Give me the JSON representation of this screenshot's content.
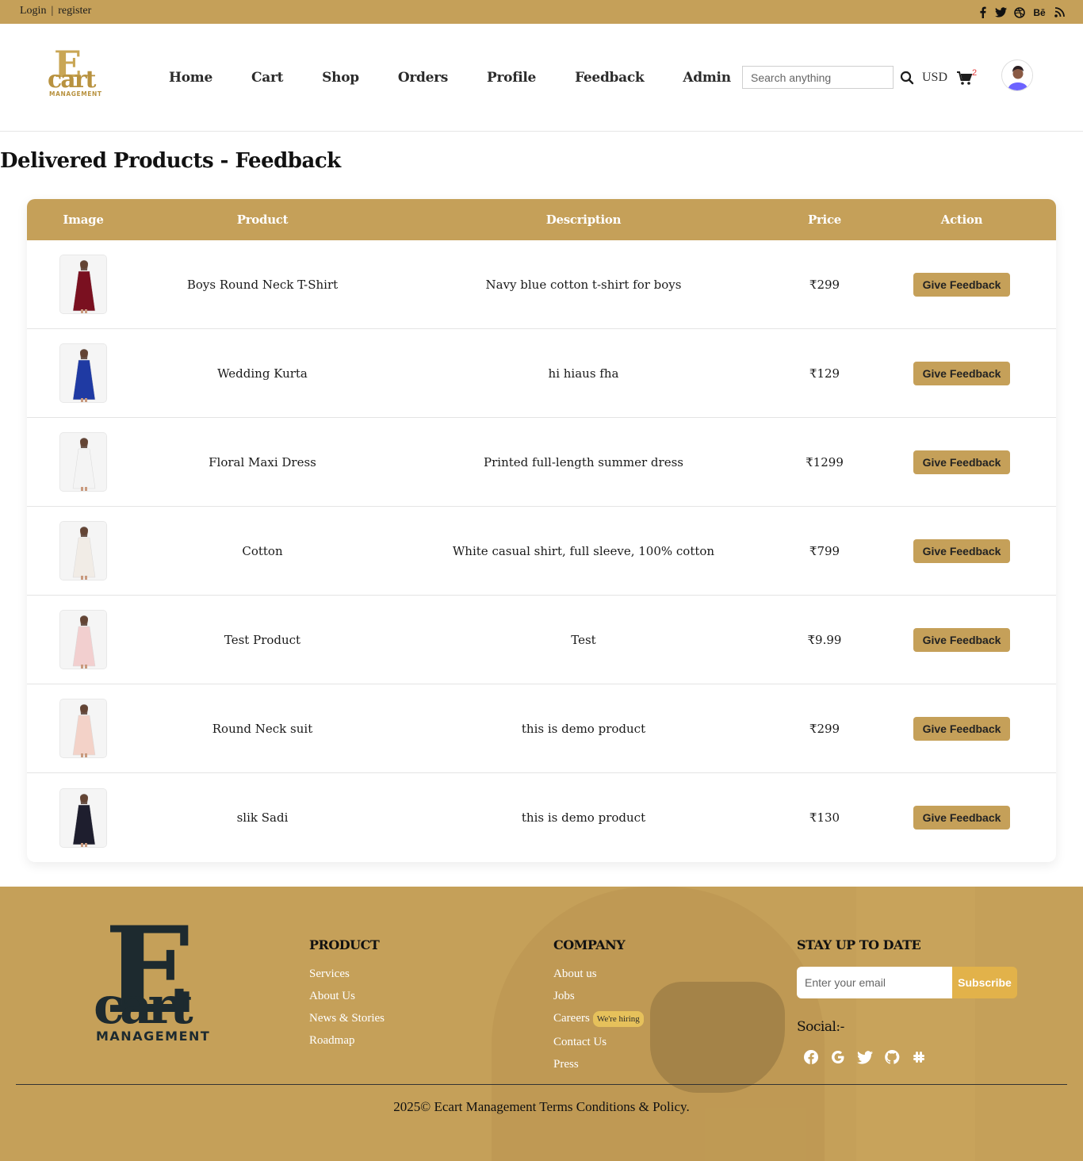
{
  "topbar": {
    "login": "Login",
    "separator": "|",
    "register": "register",
    "socials": [
      "facebook-icon",
      "twitter-icon",
      "dribbble-icon",
      "behance-icon",
      "rss-icon"
    ],
    "behance_text": "Bē"
  },
  "header": {
    "logo_text": "cart",
    "logo_sub": "MANAGEMENT",
    "nav": [
      "Home",
      "Cart",
      "Shop",
      "Orders",
      "Profile",
      "Feedback",
      "Admin"
    ],
    "search_placeholder": "Search anything",
    "currency": "USD",
    "cart_count": "2"
  },
  "main": {
    "title": "Delivered Products - Feedback",
    "columns": [
      "Image",
      "Product",
      "Description",
      "Price",
      "Action"
    ],
    "action_label": "Give Feedback",
    "rows": [
      {
        "product": "Boys Round Neck T-Shirt",
        "description": "Navy blue cotton t-shirt for boys",
        "price": "₹299",
        "dress_color": "#7a1020"
      },
      {
        "product": "Wedding Kurta",
        "description": "hi hiaus fha",
        "price": "₹129",
        "dress_color": "#1f3aa3"
      },
      {
        "product": "Floral Maxi Dress",
        "description": "Printed full-length summer dress",
        "price": "₹1299",
        "dress_color": "#f4f4f4"
      },
      {
        "product": "Cotton",
        "description": "White casual shirt, full sleeve, 100% cotton",
        "price": "₹799",
        "dress_color": "#f1ece6"
      },
      {
        "product": "Test Product",
        "description": "Test",
        "price": "₹9.99",
        "dress_color": "#f2cfcf"
      },
      {
        "product": "Round Neck suit",
        "description": "this is demo product",
        "price": "₹299",
        "dress_color": "#f3d2c8"
      },
      {
        "product": "slik Sadi",
        "description": "this is demo product",
        "price": "₹130",
        "dress_color": "#1e1e2e"
      }
    ]
  },
  "footer": {
    "logo_text": "cart",
    "logo_sub": "MANAGEMENT",
    "product": {
      "title": "PRODUCT",
      "links": [
        "Services",
        "About Us",
        "News & Stories",
        "Roadmap"
      ]
    },
    "company": {
      "title": "COMPANY",
      "links": [
        "About us",
        "Jobs",
        "Careers",
        "Contact Us",
        "Press"
      ],
      "hiring_badge": "We're hiring"
    },
    "newsletter": {
      "title": "STAY UP TO DATE",
      "placeholder": "Enter your email",
      "button": "Subscribe",
      "social_label": "Social:-"
    },
    "social_icons": [
      "facebook-icon",
      "google-icon",
      "twitter-icon",
      "github-icon",
      "slack-icon"
    ],
    "copyright": "2025© Ecart Management Terms Conditions & Policy."
  },
  "colors": {
    "accent": "#c5a059",
    "dark": "#1d2a2f"
  }
}
